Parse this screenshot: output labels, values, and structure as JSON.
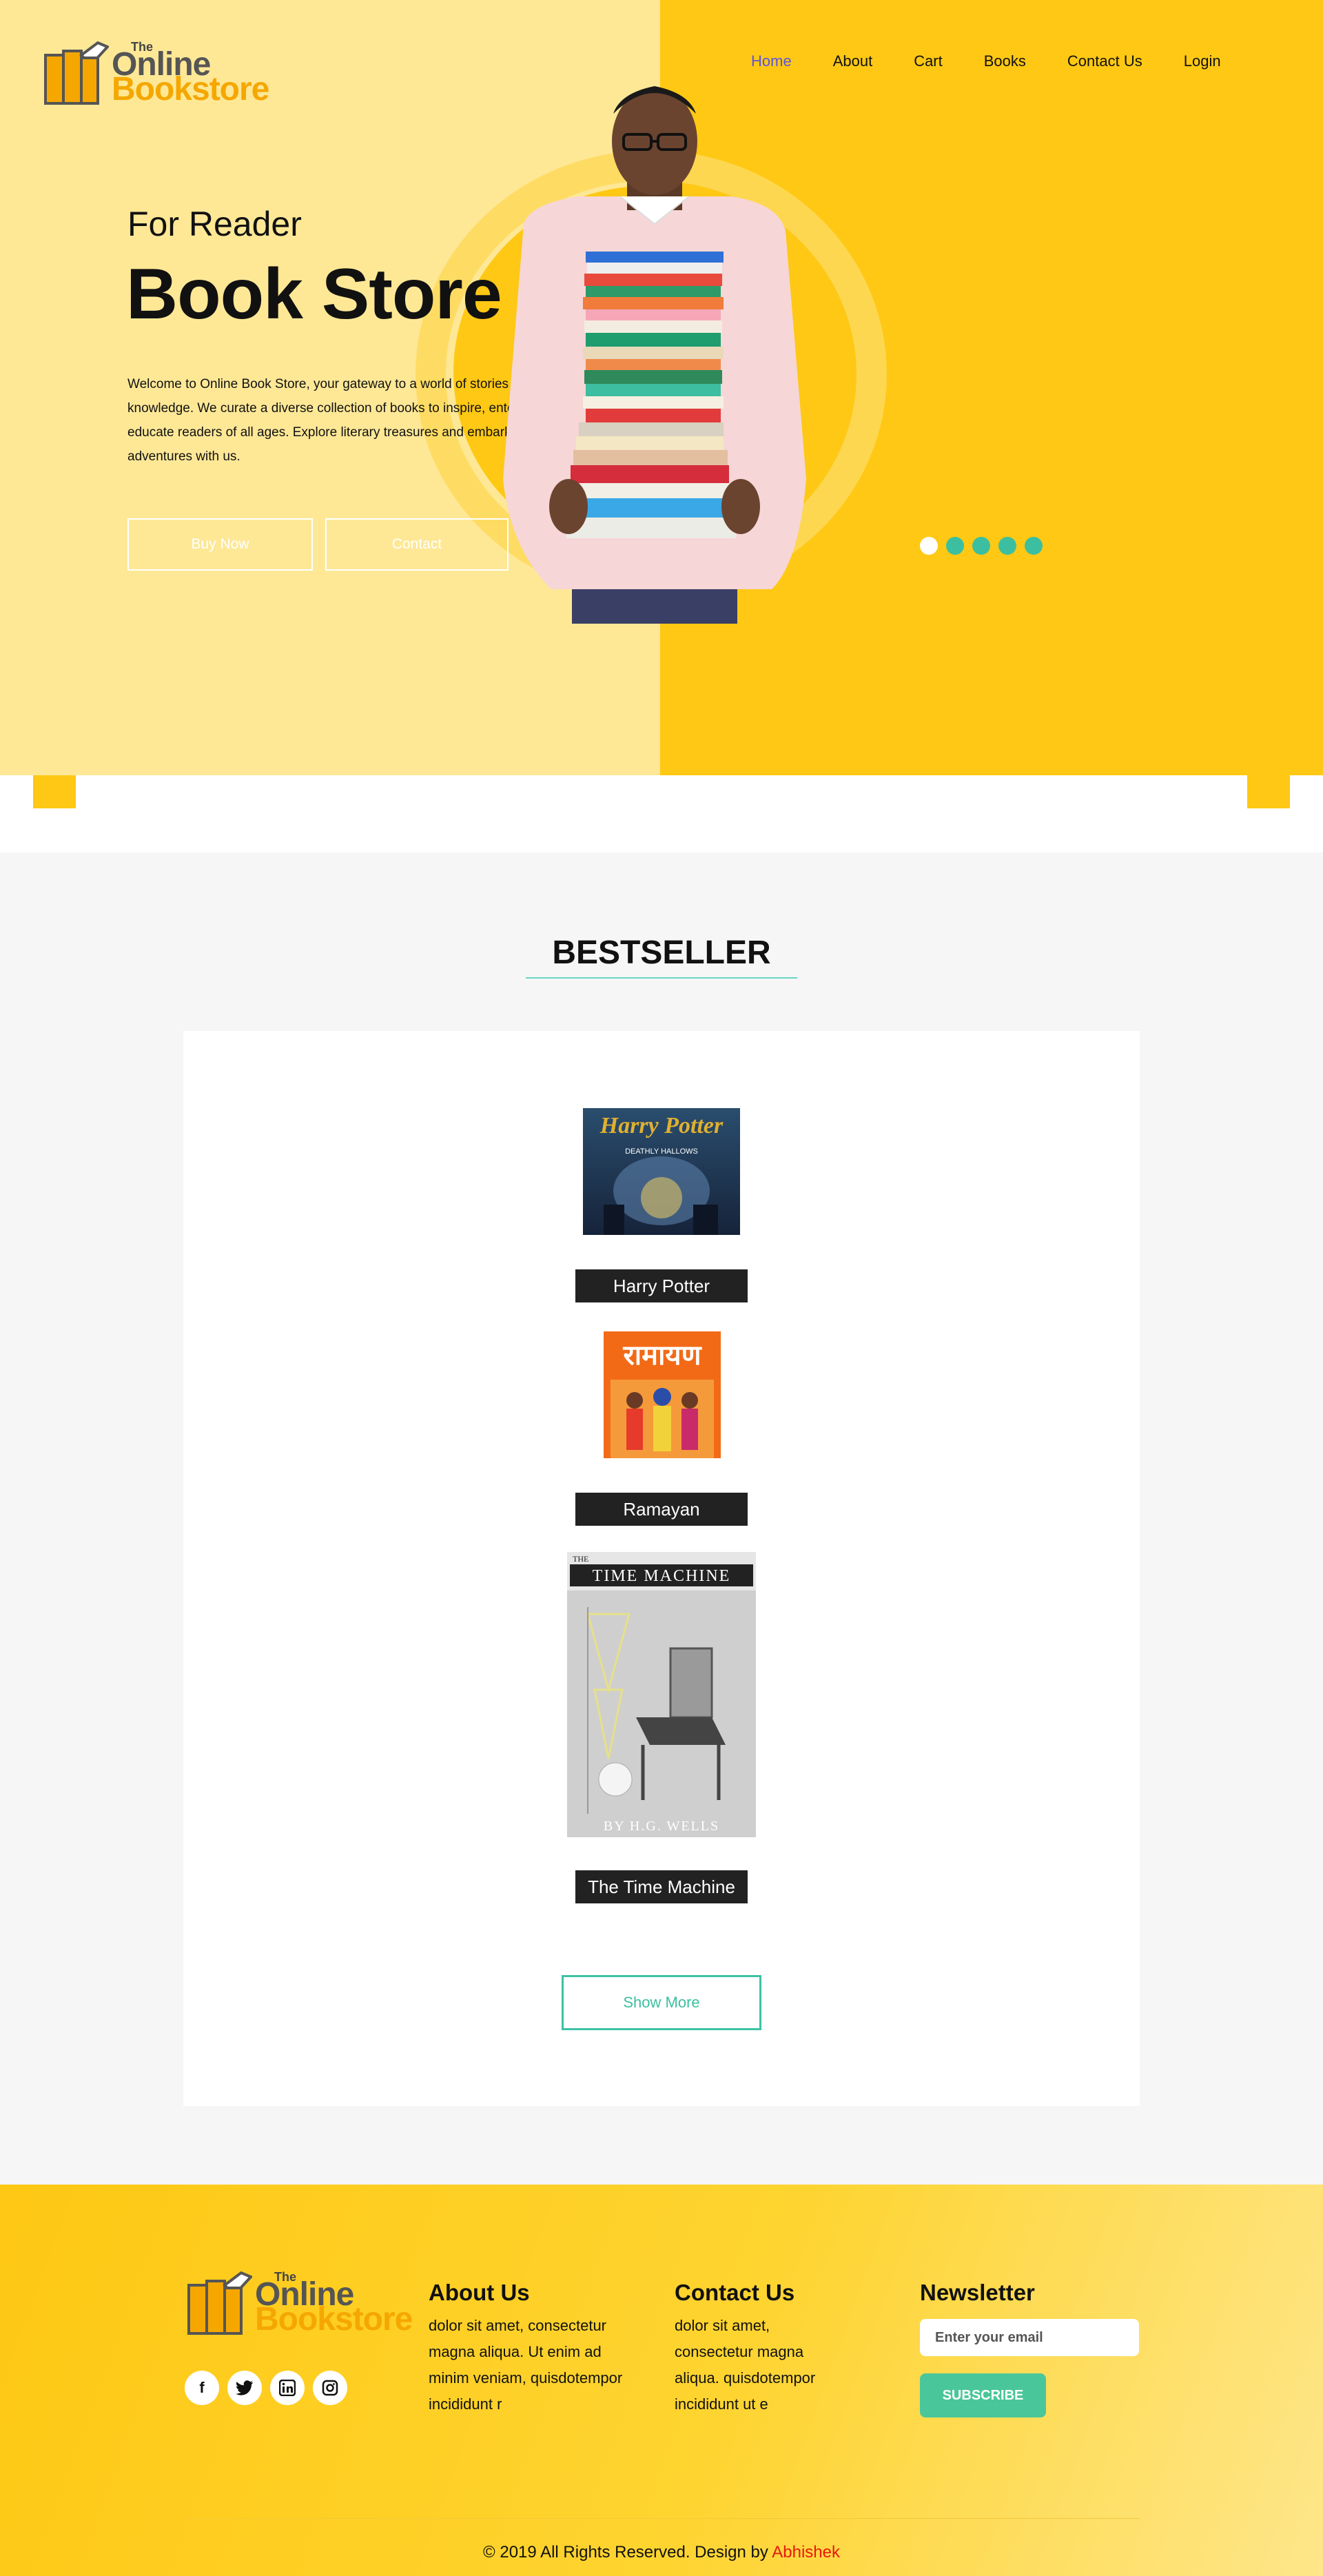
{
  "logo": {
    "the": "The",
    "online": "Online",
    "bookstore": "Bookstore"
  },
  "nav": [
    "Home",
    "About",
    "Cart",
    "Books",
    "Contact Us",
    "Login"
  ],
  "hero": {
    "subtitle": "For Reader",
    "title": "Book Store",
    "description": "Welcome to Online Book Store, your gateway to a world of stories and knowledge. We curate a diverse collection of books to inspire, entertain, and educate readers of all ages. Explore literary treasures and embark on new adventures with us.",
    "buy_label": "Buy Now",
    "contact_label": "Contact",
    "carousel_active_index": 0,
    "carousel_count": 5
  },
  "bestseller": {
    "title": "BESTSELLER",
    "books": [
      {
        "title": "Harry Potter",
        "cover_text": "Harry Potter",
        "cover_sub": "DEATHLY HALLOWS"
      },
      {
        "title": "Ramayan",
        "cover_text": "रामायण"
      },
      {
        "title": "The Time Machine",
        "cover_text": "TIME MACHINE",
        "cover_the": "THE",
        "cover_author": "BY H.G. WELLS"
      }
    ],
    "show_more": "Show More"
  },
  "footer": {
    "about": {
      "title": "About Us",
      "text": "dolor sit amet, consectetur magna aliqua. Ut enim ad minim veniam, quisdotempor incididunt r"
    },
    "contact": {
      "title": "Contact Us",
      "text": "dolor sit amet, consectetur magna aliqua. quisdotempor incididunt ut e"
    },
    "newsletter": {
      "title": "Newsletter",
      "placeholder": "Enter your email",
      "button": "SUBSCRIBE"
    },
    "social": [
      "facebook-icon",
      "twitter-icon",
      "linkedin-icon",
      "instagram-icon"
    ],
    "copyright_prefix": "© 2019 All Rights Reserved. Design by",
    "copyright_author": "Abhishek"
  },
  "colors": {
    "accent_yellow": "#fec814",
    "accent_teal": "#3cbfa0",
    "nav_active": "#5a55e0"
  }
}
